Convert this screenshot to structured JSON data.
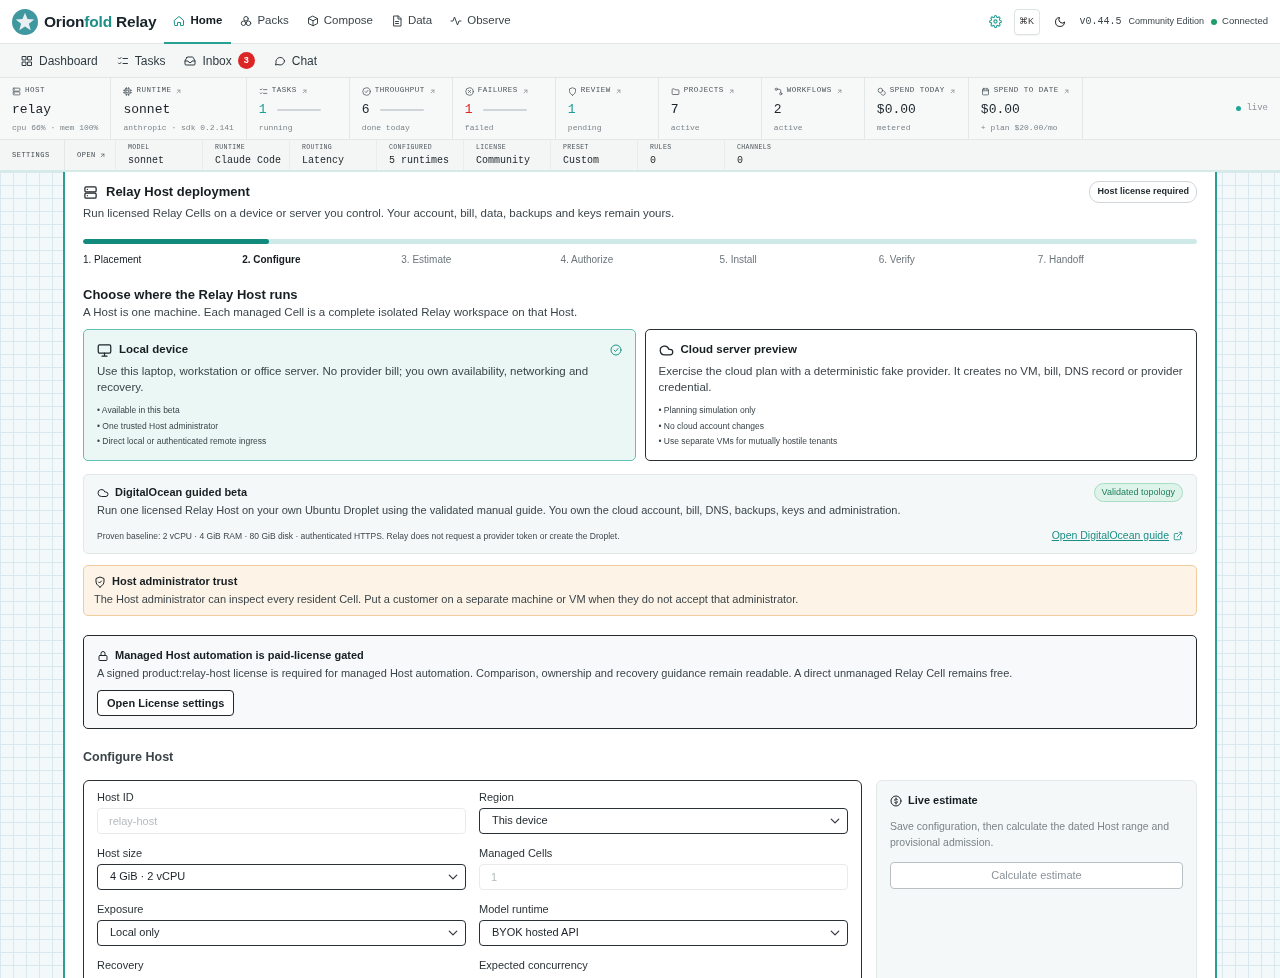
{
  "top_nav": {
    "brand": [
      {
        "text": "Orion",
        "accent": false
      },
      {
        "text": "fold",
        "accent": true
      },
      {
        "text": " Relay",
        "accent": false
      }
    ],
    "tabs": [
      {
        "label": "Home",
        "selected": true
      },
      {
        "label": "Packs",
        "selected": false
      },
      {
        "label": "Compose",
        "selected": false
      },
      {
        "label": "Data",
        "selected": false
      },
      {
        "label": "Observe",
        "selected": false
      }
    ],
    "shortcut": "⌘K",
    "version": "v0.44.5",
    "edition": "Community Edition",
    "connection": {
      "label": "Connected",
      "connected": true
    }
  },
  "sub_nav": [
    {
      "label": "Dashboard",
      "selected": false
    },
    {
      "label": "Tasks",
      "selected": false
    },
    {
      "label": "Inbox",
      "selected": false,
      "badge": "3"
    },
    {
      "label": "Chat",
      "selected": false
    }
  ],
  "stats": [
    {
      "label": "HOST",
      "link": false,
      "value": "relay",
      "sparkline": false,
      "detail": "cpu 66% · mem 100%"
    },
    {
      "label": "RUNTIME",
      "link": true,
      "value": "sonnet",
      "sparkline": false,
      "detail": "anthropic · sdk 0.2.141"
    },
    {
      "label": "TASKS",
      "link": true,
      "value": "1",
      "color": "#1a9e95",
      "sparkline": true,
      "detail": "running"
    },
    {
      "label": "THROUGHPUT",
      "link": true,
      "value": "6",
      "sparkline": true,
      "detail": "done today"
    },
    {
      "label": "FAILURES",
      "link": true,
      "value": "1",
      "color": "#dc2626",
      "sparkline": true,
      "detail": "failed"
    },
    {
      "label": "REVIEW",
      "link": true,
      "value": "1",
      "color": "#1a9e95",
      "sparkline": false,
      "detail": "pending"
    },
    {
      "label": "PROJECTS",
      "link": true,
      "value": "7",
      "sparkline": false,
      "detail": "active"
    },
    {
      "label": "WORKFLOWS",
      "link": true,
      "value": "2",
      "sparkline": false,
      "detail": "active"
    },
    {
      "label": "SPEND TODAY",
      "link": true,
      "value": "$0.00",
      "sparkline": false,
      "detail": "metered"
    },
    {
      "label": "SPEND TO DATE",
      "link": true,
      "value": "$0.00",
      "sparkline": false,
      "detail": "+ plan $20.00/mo"
    }
  ],
  "live": {
    "label": "live",
    "on": true
  },
  "settings_bar": {
    "title": "SETTINGS",
    "open": "OPEN",
    "items": [
      {
        "label": "MODEL",
        "value": "sonnet"
      },
      {
        "label": "RUNTIME",
        "value": "Claude Code"
      },
      {
        "label": "ROUTING",
        "value": "Latency"
      },
      {
        "label": "CONFIGURED",
        "value": "5 runtimes"
      },
      {
        "label": "LICENSE",
        "value": "Community"
      },
      {
        "label": "PRESET",
        "value": "Custom"
      },
      {
        "label": "RULES",
        "value": "0"
      },
      {
        "label": "CHANNELS",
        "value": "0"
      }
    ]
  },
  "deployment": {
    "title": "Relay Host deployment",
    "badge": "Host license required",
    "description": "Run licensed Relay Cells on a device or server you control. Your account, bill, data, backups and keys remain yours.",
    "progress": {
      "level": 0.167
    },
    "steps": [
      {
        "label": "1. Placement",
        "reached": true,
        "current": false
      },
      {
        "label": "2. Configure",
        "reached": true,
        "current": true
      },
      {
        "label": "3. Estimate",
        "reached": false,
        "current": false
      },
      {
        "label": "4. Authorize",
        "reached": false,
        "current": false
      },
      {
        "label": "5. Install",
        "reached": false,
        "current": false
      },
      {
        "label": "6. Verify",
        "reached": false,
        "current": false
      },
      {
        "label": "7. Handoff",
        "reached": false,
        "current": false
      }
    ]
  },
  "placement": {
    "title": "Choose where the Relay Host runs",
    "description": "A Host is one machine. Each managed Cell is a complete isolated Relay workspace on that Host.",
    "options": [
      {
        "title": "Local device",
        "selected": true,
        "description": "Use this laptop, workstation or office server. No provider bill; you own availability, networking and recovery.",
        "points": [
          "• Available in this beta",
          "• One trusted Host administrator",
          "• Direct local or authenticated remote ingress"
        ]
      },
      {
        "title": "Cloud server preview",
        "selected": false,
        "description": "Exercise the cloud plan with a deterministic fake provider. It creates no VM, bill, DNS record or provider credential.",
        "points": [
          "• Planning simulation only",
          "• No cloud account changes",
          "• Use separate VMs for mutually hostile tenants"
        ]
      }
    ]
  },
  "guide": {
    "title": "DigitalOcean guided beta",
    "badge": "Validated topology",
    "description": "Run one licensed Relay Host on your own Ubuntu Droplet using the validated manual guide. You own the cloud account, bill, DNS, backups, keys and administration.",
    "note": "Proven baseline: 2 vCPU · 4 GiB RAM · 80 GiB disk · authenticated HTTPS. Relay does not request a provider token or create the Droplet.",
    "link": "Open DigitalOcean guide"
  },
  "trust_notice": {
    "title": "Host administrator trust",
    "text": "The Host administrator can inspect every resident Cell. Put a customer on a separate machine or VM when they do not accept that administrator."
  },
  "license_gate": {
    "title": "Managed Host automation is paid-license gated",
    "text": "A signed product:relay-host license is required for managed Host automation. Comparison, ownership and recovery guidance remain readable. A direct unmanaged Relay Cell remains free.",
    "button": "Open License settings"
  },
  "configure": {
    "title": "Configure Host",
    "fields": [
      {
        "label": "Host ID",
        "kind": "input",
        "placeholder": "relay-host",
        "disabled": true
      },
      {
        "label": "Region",
        "kind": "select",
        "value": "This device",
        "disabled": false
      },
      {
        "label": "Host size",
        "kind": "select",
        "value": "4 GiB · 2 vCPU",
        "disabled": false
      },
      {
        "label": "Managed Cells",
        "kind": "input",
        "placeholder": "1",
        "disabled": true
      },
      {
        "label": "Exposure",
        "kind": "select",
        "value": "Local only",
        "disabled": false
      },
      {
        "label": "Model runtime",
        "kind": "select",
        "value": "BYOK hosted API",
        "disabled": false
      },
      {
        "label": "Recovery",
        "kind": "label"
      },
      {
        "label": "Expected concurrency",
        "kind": "label"
      }
    ],
    "estimate": {
      "title": "Live estimate",
      "text": "Save configuration, then calculate the dated Host range and provisional admission.",
      "button": "Calculate estimate",
      "button_disabled": true
    }
  }
}
